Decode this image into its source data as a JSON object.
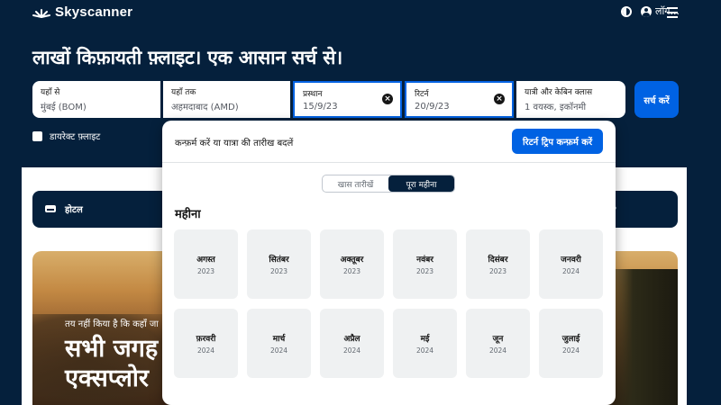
{
  "header": {
    "brand": "Skyscanner",
    "login_label": "लॉग..."
  },
  "hero_title": "लाखों किफ़ायती फ़्लाइट। एक आसान सर्च से।",
  "search": {
    "from": {
      "label": "यहाँ से",
      "value": "मुंबई (BOM)"
    },
    "to": {
      "label": "यहाँ तक",
      "value": "अहमदाबाद (AMD)"
    },
    "depart": {
      "label": "प्रस्थान",
      "value": "15/9/23"
    },
    "return": {
      "label": "रिटर्न",
      "value": "20/9/23"
    },
    "travellers": {
      "label": "यात्री और केबिन क्लास",
      "value": "1 वयस्क, इकॉनमी"
    },
    "search_button": "सर्च करें",
    "direct_label": "डायरेक्ट फ़्लाइट"
  },
  "page": {
    "hotel_label": "होटल",
    "hotel_right": "ें",
    "banner_small": "तय नहीं किया है कि कहाँ जा",
    "banner_line1": "सभी जगह",
    "banner_line2": "एक्सप्लोर"
  },
  "popup": {
    "title": "कन्फ़र्म करें या यात्रा की तारीख बदलें",
    "confirm_button": "रिटर्न ट्रिप कन्फ़र्म करें",
    "toggle_specific": "खास तारीखें",
    "toggle_month": "पूरा महीना",
    "months_heading": "महीना",
    "months": [
      {
        "name": "अगस्त",
        "year": "2023"
      },
      {
        "name": "सितंबर",
        "year": "2023"
      },
      {
        "name": "अक्तूबर",
        "year": "2023"
      },
      {
        "name": "नवंबर",
        "year": "2023"
      },
      {
        "name": "दिसंबर",
        "year": "2023"
      },
      {
        "name": "जनवरी",
        "year": "2024"
      },
      {
        "name": "फ़रवरी",
        "year": "2024"
      },
      {
        "name": "मार्च",
        "year": "2024"
      },
      {
        "name": "अप्रैल",
        "year": "2024"
      },
      {
        "name": "मई",
        "year": "2024"
      },
      {
        "name": "जून",
        "year": "2024"
      },
      {
        "name": "जुलाई",
        "year": "2024"
      }
    ]
  },
  "colors": {
    "navy": "#05203c",
    "accent_blue": "#0062e3"
  }
}
